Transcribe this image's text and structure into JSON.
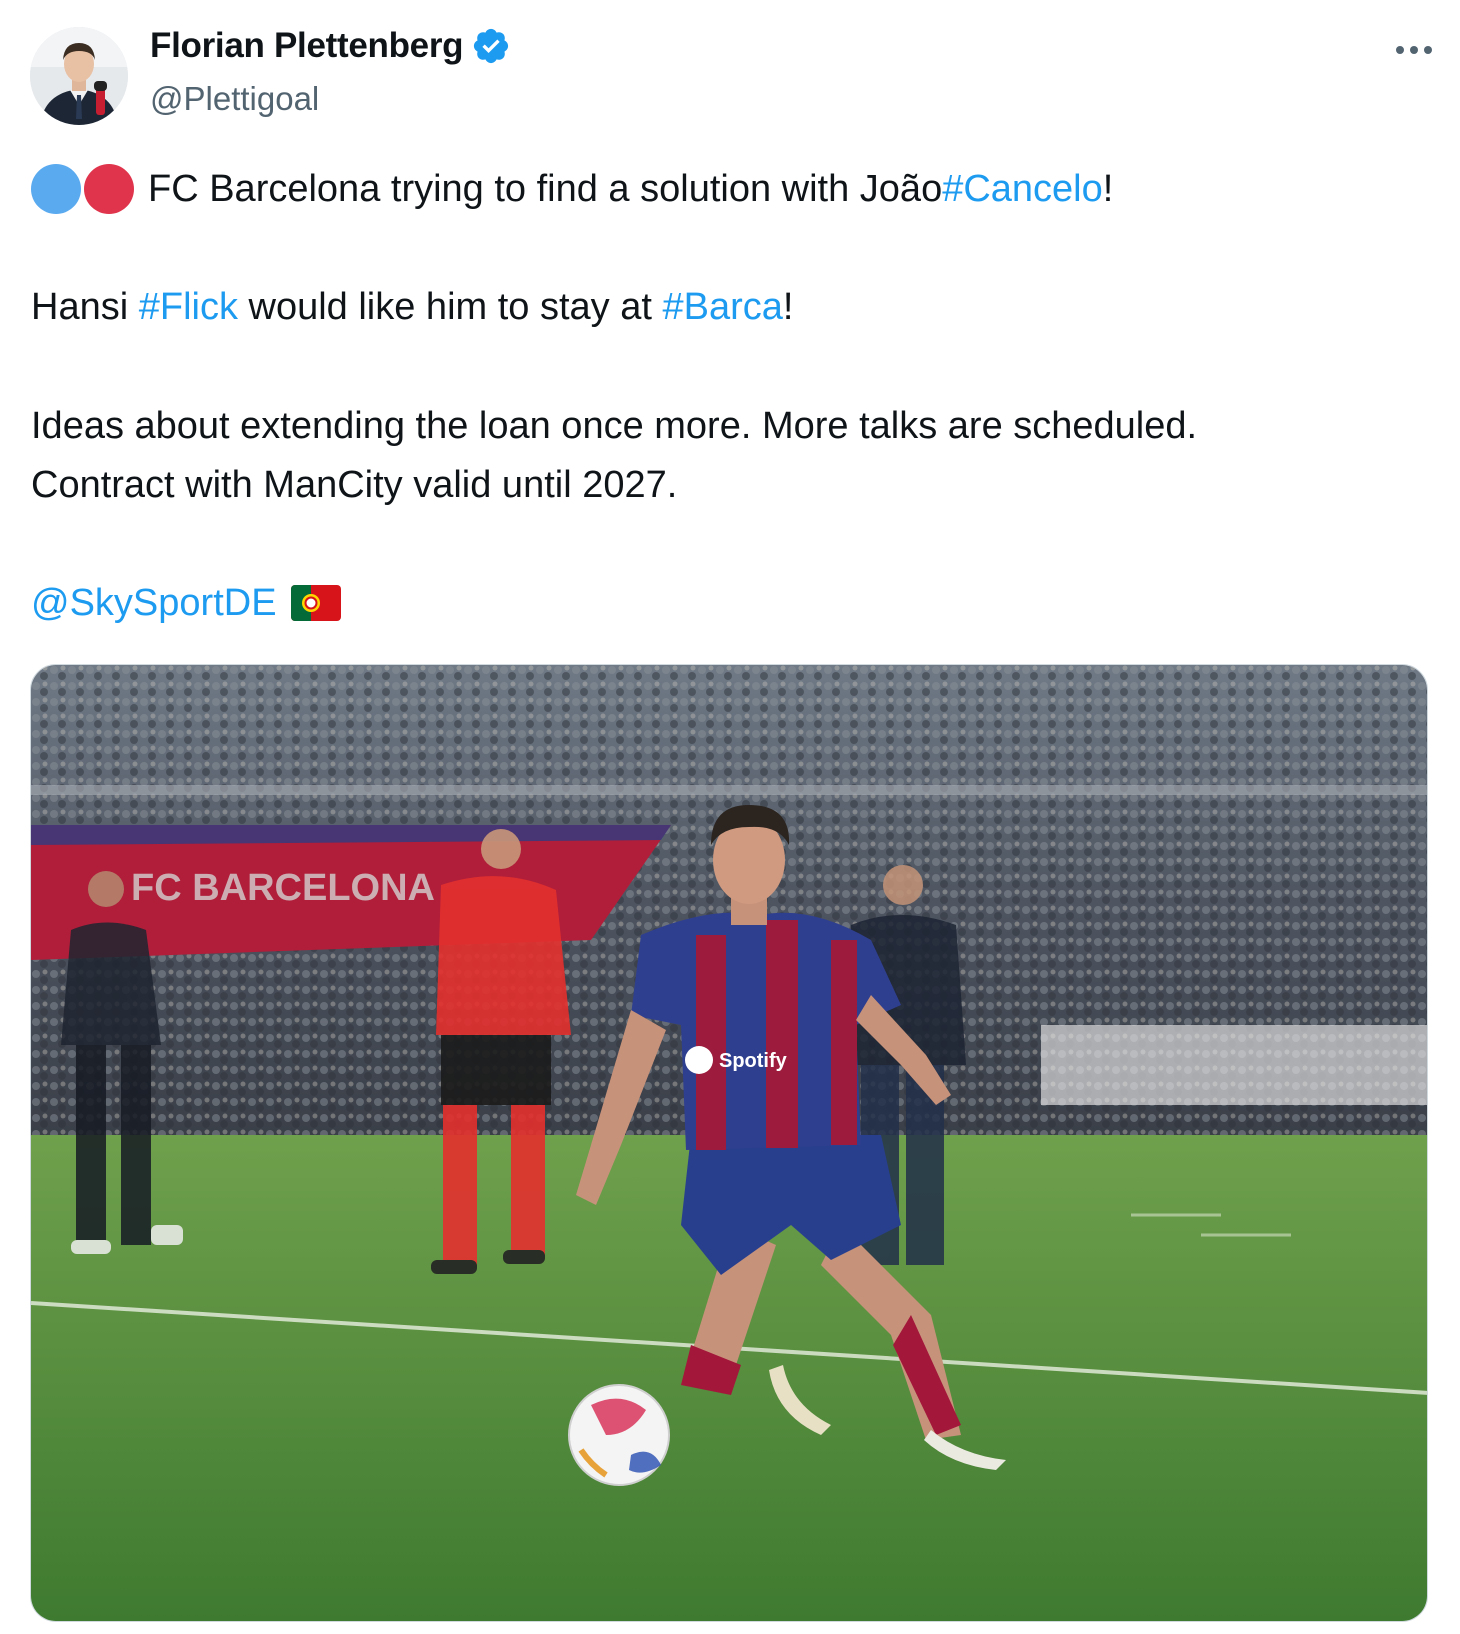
{
  "author": {
    "display_name": "Florian Plettenberg",
    "handle": "@Plettigoal",
    "verified": true,
    "avatar_icon": "person-avatar"
  },
  "tweet": {
    "line1": {
      "emoji": [
        "blue-circle",
        "red-circle"
      ],
      "text_before": "FC Barcelona trying to find a solution with João ",
      "hashtag": "#Cancelo",
      "text_after": "!"
    },
    "line2": {
      "text_before": "Hansi ",
      "hashtag1": "#Flick",
      "text_middle": " would like him to stay at ",
      "hashtag2": "#Barca",
      "text_after": "!"
    },
    "line3": "Ideas about extending the loan once more. More talks are scheduled.",
    "line4": "Contract with ManCity valid until 2027.",
    "line5": {
      "mention": "@SkySportDE",
      "emoji": "portugal-flag"
    }
  },
  "media": {
    "photo_icon": "football-player-photo",
    "banner_text": "FC BARCELONA"
  },
  "colors": {
    "link": "#1d9bf0",
    "verified": "#1d9bf0",
    "handle": "#536471",
    "pitch": "#4d8a3a"
  }
}
